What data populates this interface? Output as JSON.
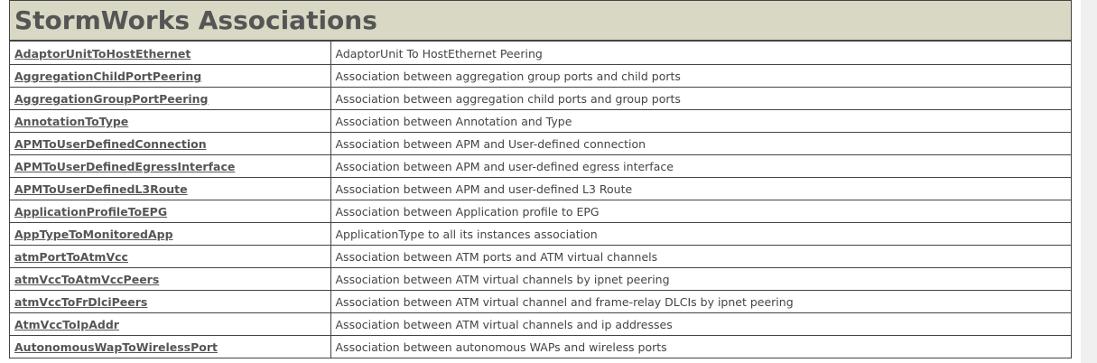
{
  "page": {
    "title": "StormWorks Associations"
  },
  "rows": [
    {
      "name": "AdaptorUnitToHostEthernet",
      "description": "AdaptorUnit To HostEthernet Peering"
    },
    {
      "name": "AggregationChildPortPeering",
      "description": "Association between aggregation group ports and child ports"
    },
    {
      "name": "AggregationGroupPortPeering",
      "description": "Association between aggregation child ports and group ports"
    },
    {
      "name": "AnnotationToType",
      "description": "Association between Annotation and Type"
    },
    {
      "name": "APMToUserDefinedConnection",
      "description": "Association between APM and User-defined connection"
    },
    {
      "name": "APMToUserDefinedEgressInterface",
      "description": "Association between APM and user-defined egress interface"
    },
    {
      "name": "APMToUserDefinedL3Route",
      "description": "Association between APM and user-defined L3 Route"
    },
    {
      "name": "ApplicationProfileToEPG",
      "description": "Association between Application profile to EPG"
    },
    {
      "name": "AppTypeToMonitoredApp",
      "description": "ApplicationType to all its instances association"
    },
    {
      "name": "atmPortToAtmVcc",
      "description": "Association between ATM ports and ATM virtual channels"
    },
    {
      "name": "atmVccToAtmVccPeers",
      "description": "Association between ATM virtual channels by ipnet peering"
    },
    {
      "name": "atmVccToFrDlciPeers",
      "description": "Association between ATM virtual channel and frame-relay DLCIs by ipnet peering"
    },
    {
      "name": "AtmVccToIpAddr",
      "description": "Association between ATM virtual channels and ip addresses"
    },
    {
      "name": "AutonomousWapToWirelessPort",
      "description": "Association between autonomous WAPs and wireless ports"
    }
  ]
}
